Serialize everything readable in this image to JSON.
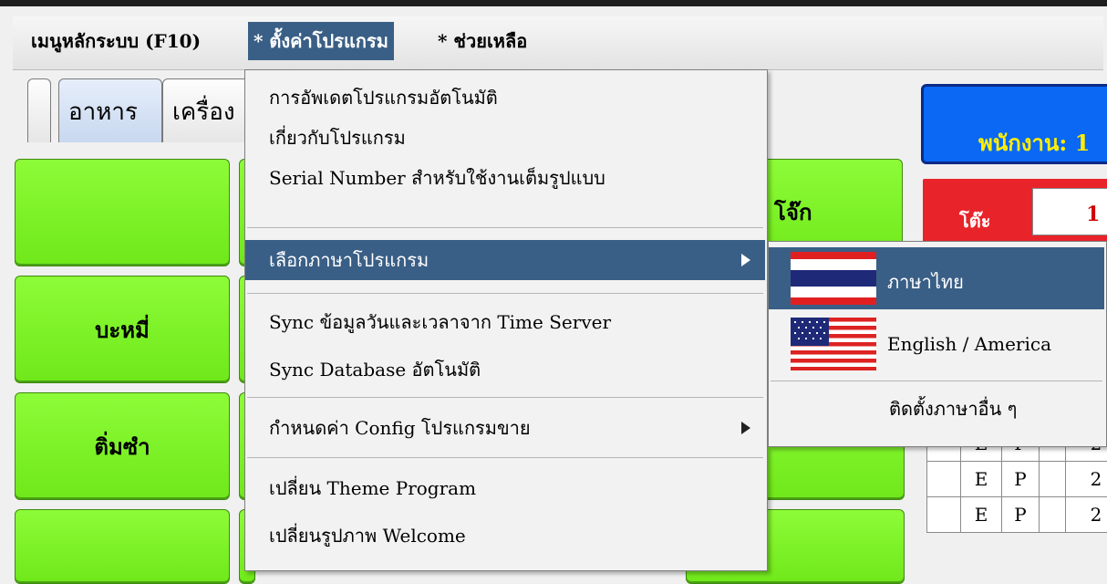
{
  "menubar": {
    "main_menu": "เมนูหลักระบบ (F10)",
    "settings": "* ตั้งค่าโปรแกรม",
    "help": "* ช่วยเหลือ"
  },
  "tabs": {
    "food": "อาหาร",
    "drink": "เครื่อง"
  },
  "buttons": {
    "noodle": "บะหมี่",
    "dimsum": "ติ่มซำ",
    "jok": "โจ๊ก"
  },
  "staff": {
    "label": "พนักงาน: 1"
  },
  "table": {
    "label": "โต๊ะ",
    "value": "1"
  },
  "grid": {
    "rows": [
      [
        "E",
        "P",
        "2"
      ],
      [
        "E",
        "P",
        "2"
      ],
      [
        "E",
        "P",
        "2"
      ]
    ]
  },
  "settings_menu": {
    "auto_update": "การอัพเดตโปรแกรมอัตโนมัติ",
    "about": "เกี่ยวกับโปรแกรม",
    "serial": "Serial Number สำหรับใช้งานเต็มรูปแบบ",
    "language": "เลือกภาษาโปรแกรม",
    "sync_time": "Sync ข้อมูลวันและเวลาจาก Time Server",
    "sync_db": "Sync Database อัตโนมัติ",
    "config": "กำหนดค่า Config โปรแกรมขาย",
    "theme": "เปลี่ยน Theme Program",
    "welcome": "เปลี่ยนรูปภาพ Welcome"
  },
  "language_menu": {
    "thai": "ภาษาไทย",
    "english": "English / America",
    "install": "ติดตั้งภาษาอื่น ๆ"
  },
  "colors": {
    "highlight": "#3a5f86",
    "green_button": "#7cf526",
    "staff_blue": "#0a68f5",
    "table_red": "#e8242a"
  }
}
